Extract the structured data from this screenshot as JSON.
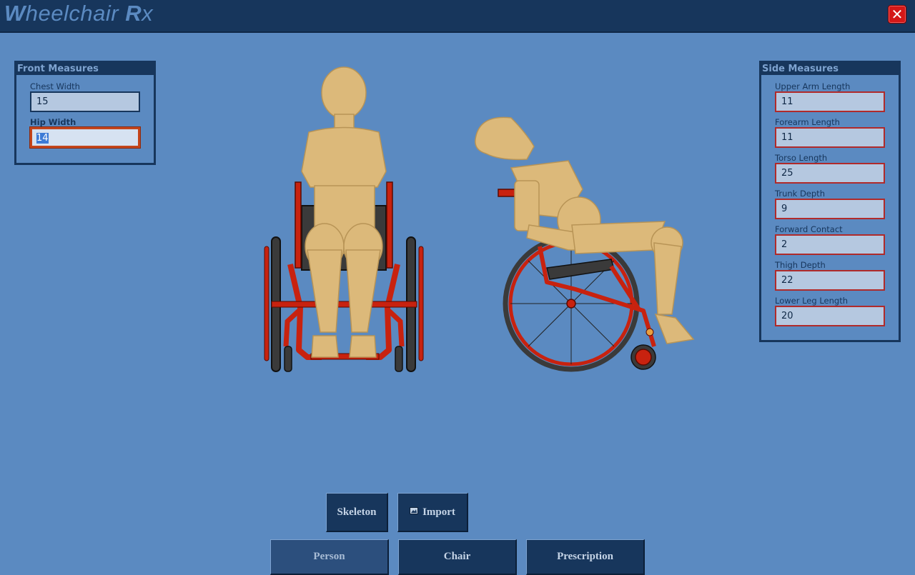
{
  "app": {
    "title_w": "W",
    "title_heelchair": "heelchair ",
    "title_r": "R",
    "title_x": "x",
    "close_symbol": "✕"
  },
  "front_measures": {
    "title": "Front Measures",
    "fields": [
      {
        "label": "Chest Width",
        "value": "15"
      },
      {
        "label": "Hip Width",
        "value": "14"
      }
    ]
  },
  "side_measures": {
    "title": "Side Measures",
    "fields": [
      {
        "label": "Upper Arm Length",
        "value": "11"
      },
      {
        "label": "Forearm Length",
        "value": "11"
      },
      {
        "label": "Torso Length",
        "value": "25"
      },
      {
        "label": "Trunk Depth",
        "value": "9"
      },
      {
        "label": "Forward Contact",
        "value": "2"
      },
      {
        "label": "Thigh Depth",
        "value": "22"
      },
      {
        "label": "Lower Leg Length",
        "value": "20"
      }
    ]
  },
  "tools": {
    "skeleton_label": "Skeleton",
    "import_label": "Import"
  },
  "tabs": [
    {
      "label": "Person",
      "selected": true
    },
    {
      "label": "Chair",
      "selected": false
    },
    {
      "label": "Prescription",
      "selected": false
    }
  ],
  "colors": {
    "background": "#5b8ac1",
    "dark_navy": "#17365c",
    "chair_red": "#c8220f",
    "body_tan": "#dcb97a"
  }
}
